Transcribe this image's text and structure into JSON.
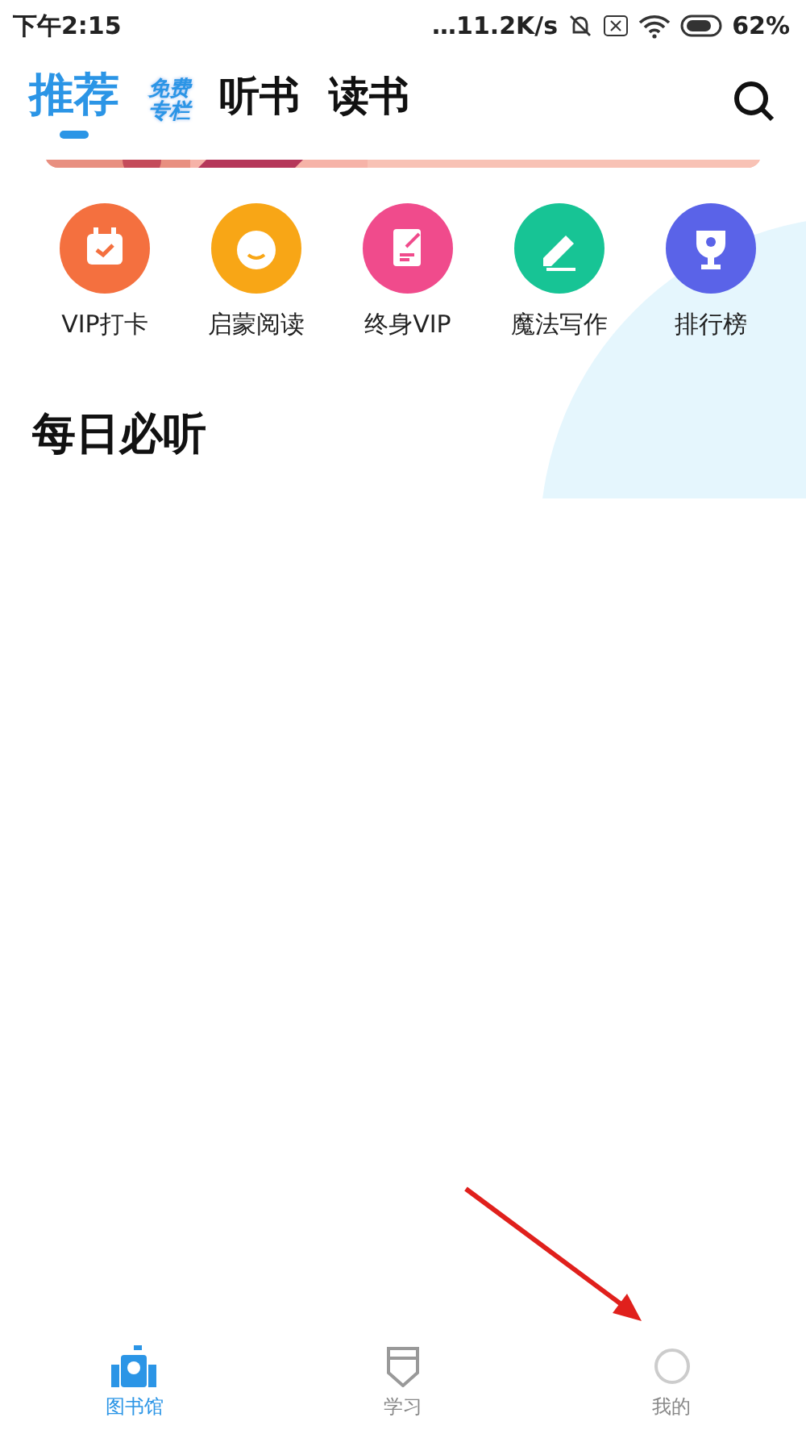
{
  "status_bar": {
    "time": "下午2:15",
    "network_speed": "…11.2K/s",
    "battery": "62%"
  },
  "tabs": [
    {
      "label": "推荐",
      "kind": "text",
      "selected": true
    },
    {
      "label": "免费",
      "label_2": "专栏",
      "kind": "logo",
      "selected": false
    },
    {
      "label": "听书",
      "kind": "text",
      "selected": false
    },
    {
      "label": "读书",
      "kind": "text",
      "selected": false
    }
  ],
  "shortcuts": [
    {
      "label": "VIP打卡",
      "kind": "calendar",
      "color": "#f4703f"
    },
    {
      "label": "启蒙阅读",
      "kind": "baby",
      "color": "#f8a616"
    },
    {
      "label": "终身VIP",
      "kind": "note",
      "color": "#f04b8c"
    },
    {
      "label": "魔法写作",
      "kind": "pencil",
      "color": "#17c495"
    },
    {
      "label": "排行榜",
      "kind": "trophy",
      "color": "#5a63e8"
    }
  ],
  "section": {
    "title": "每日必听"
  },
  "bottom_nav": [
    {
      "label": "图书馆",
      "kind": "library",
      "selected": true
    },
    {
      "label": "学习",
      "kind": "learn",
      "selected": false
    },
    {
      "label": "我的",
      "kind": "me",
      "selected": false
    }
  ]
}
